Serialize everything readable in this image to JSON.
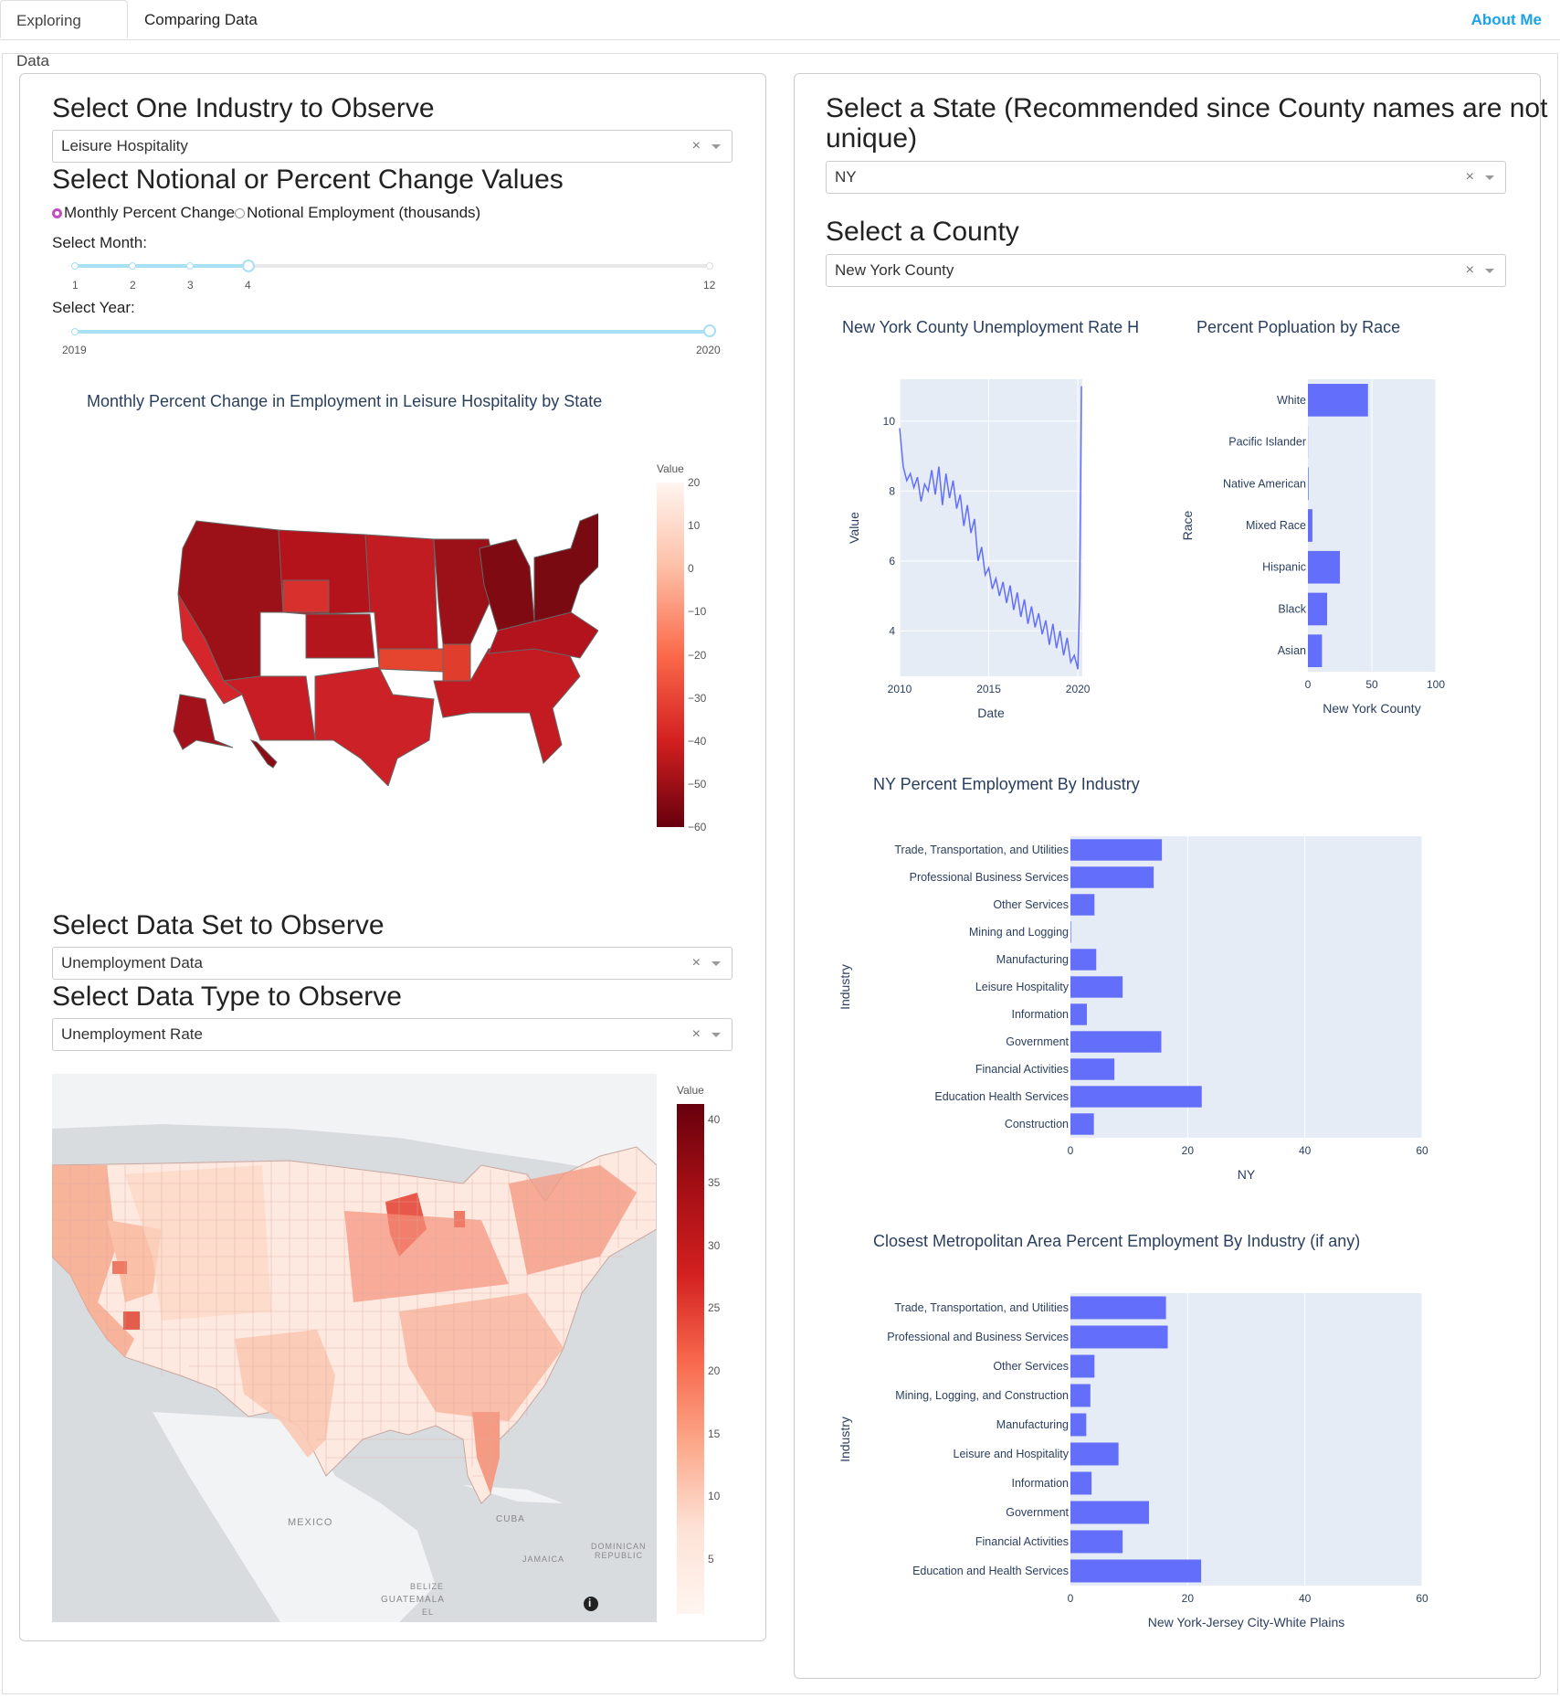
{
  "tabs": {
    "exploring": "Exploring Data",
    "comparing": "Comparing Data",
    "about": "About Me"
  },
  "left": {
    "industry_heading": "Select One Industry to Observe",
    "industry_value": "Leisure Hospitality",
    "clear_glyph": "×",
    "values_heading": "Select Notional or Percent Change Values",
    "radio_percent": "Monthly Percent Change",
    "radio_notional": "Notional Employment (thousands)",
    "month_label": "Select Month:",
    "month_ticks": [
      "1",
      "2",
      "3",
      "4",
      "12"
    ],
    "month_selected": 4,
    "year_label": "Select Year:",
    "year_ticks": [
      "2019",
      "2020"
    ],
    "year_selected": "2020",
    "map1_title": "Monthly Percent Change in Employment in Leisure  Hospitality by State",
    "map1_colorbar_title": "Value",
    "map1_colorbar_ticks": [
      "20",
      "10",
      "0",
      "−10",
      "−20",
      "−30",
      "−40",
      "−50",
      "−60"
    ],
    "dataset_heading": "Select Data Set to Observe",
    "dataset_value": "Unemployment Data",
    "datatype_heading": "Select Data Type to Observe",
    "datatype_value": "Unemployment Rate",
    "map2_colorbar_title": "Value",
    "map2_colorbar_ticks": [
      "40",
      "35",
      "30",
      "25",
      "20",
      "15",
      "10",
      "5"
    ],
    "map2_labels": {
      "mexico": "MEXICO",
      "cuba": "CUBA",
      "jamaica": "JAMAICA",
      "dominican1": "DOMINICAN",
      "dominican2": "REPUBLIC",
      "belize": "BELIZE",
      "guatemala": "GUATEMALA",
      "el": "EL",
      "info": "i"
    }
  },
  "right": {
    "state_heading_line1": "Select a State (Recommended since County names are not",
    "state_heading_line2": "unique)",
    "state_value": "NY",
    "county_heading": "Select a County",
    "county_value": "New York County",
    "clear_glyph": "×",
    "colors": {
      "bar": "#636efa",
      "plot_bg": "#e5ecf6",
      "title": "#2a3f5f"
    }
  },
  "chart_data": [
    {
      "type": "line",
      "title": "New York County Unemployment Rate H",
      "xlabel": "Date",
      "ylabel": "Value",
      "xticks": [
        "2010",
        "2015",
        "2020"
      ],
      "yticks": [
        "4",
        "6",
        "8",
        "10"
      ],
      "xlim": [
        2010,
        2020.25
      ],
      "ylim": [
        2.7,
        11.2
      ],
      "x": [
        2010.0,
        2010.2,
        2010.4,
        2010.6,
        2010.8,
        2011.0,
        2011.2,
        2011.4,
        2011.6,
        2011.8,
        2012.0,
        2012.2,
        2012.4,
        2012.6,
        2012.8,
        2013.0,
        2013.2,
        2013.4,
        2013.6,
        2013.8,
        2014.0,
        2014.2,
        2014.4,
        2014.6,
        2014.8,
        2015.0,
        2015.2,
        2015.4,
        2015.6,
        2015.8,
        2016.0,
        2016.2,
        2016.4,
        2016.6,
        2016.8,
        2017.0,
        2017.2,
        2017.4,
        2017.6,
        2017.8,
        2018.0,
        2018.2,
        2018.4,
        2018.6,
        2018.8,
        2019.0,
        2019.2,
        2019.4,
        2019.6,
        2019.8,
        2020.0,
        2020.1,
        2020.2
      ],
      "y": [
        9.8,
        8.7,
        8.3,
        8.5,
        8.1,
        8.4,
        7.7,
        8.2,
        8.0,
        8.6,
        7.9,
        8.7,
        7.6,
        8.5,
        7.8,
        8.3,
        7.5,
        7.9,
        7.0,
        7.6,
        6.8,
        7.2,
        6.0,
        6.4,
        5.6,
        5.8,
        5.2,
        5.5,
        5.0,
        5.4,
        4.8,
        5.3,
        4.6,
        5.1,
        4.4,
        4.9,
        4.2,
        4.7,
        4.1,
        4.5,
        3.9,
        4.3,
        3.6,
        4.2,
        3.5,
        4.0,
        3.3,
        3.8,
        3.1,
        3.3,
        2.9,
        5.0,
        11.0
      ]
    },
    {
      "type": "bar",
      "orientation": "horizontal",
      "title": "Percent Popluation by Race",
      "xlabel": "New York County",
      "ylabel": "Race",
      "categories": [
        "White",
        "Pacific Islander",
        "Native American",
        "Mixed Race",
        "Hispanic",
        "Black",
        "Asian"
      ],
      "values": [
        47,
        0.1,
        0.5,
        3.5,
        25,
        15,
        11
      ],
      "xticks": [
        "0",
        "50",
        "100"
      ],
      "xlim": [
        0,
        100
      ]
    },
    {
      "type": "bar",
      "orientation": "horizontal",
      "title": "NY Percent Employment By Industry",
      "xlabel": "NY",
      "ylabel": "Industry",
      "categories": [
        "Trade, Transportation, and Utilities",
        "Professional  Business Services",
        "Other Services",
        "Mining and Logging",
        "Manufacturing",
        "Leisure  Hospitality",
        "Information",
        "Government",
        "Financial Activities",
        "Education  Health Services",
        "Construction"
      ],
      "values": [
        15.6,
        14.2,
        4.1,
        0.1,
        4.4,
        8.9,
        2.8,
        15.5,
        7.5,
        22.4,
        4.0
      ],
      "xticks": [
        "0",
        "20",
        "40",
        "60"
      ],
      "xlim": [
        0,
        60
      ]
    },
    {
      "type": "bar",
      "orientation": "horizontal",
      "title": "Closest Metropolitan Area Percent Employment By Industry (if any)",
      "xlabel": "New York-Jersey City-White Plains",
      "ylabel": "Industry",
      "categories": [
        "Trade, Transportation, and Utilities",
        "Professional and Business Services",
        "Other Services",
        "Mining, Logging, and Construction",
        "Manufacturing",
        "Leisure and Hospitality",
        "Information",
        "Government",
        "Financial Activities",
        "Education and Health Services"
      ],
      "values": [
        16.3,
        16.6,
        4.1,
        3.4,
        2.7,
        8.2,
        3.6,
        13.4,
        8.9,
        22.3
      ],
      "xticks": [
        "0",
        "20",
        "40",
        "60"
      ],
      "xlim": [
        0,
        60
      ]
    }
  ]
}
